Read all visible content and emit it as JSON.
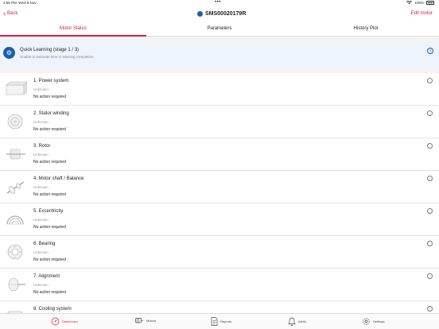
{
  "status_bar": {
    "time": "4:55 PM",
    "date": "Wed 8 Nov",
    "dots": "•••",
    "battery": "100%"
  },
  "nav": {
    "back_label": "Back",
    "title": "SMS00020179R",
    "edit_label": "Edit motor"
  },
  "tabs": [
    {
      "label": "Motor Status"
    },
    {
      "label": "Parameters"
    },
    {
      "label": "History Plot"
    }
  ],
  "learning": {
    "title": "Quick Learning (stage 1 / 3)",
    "subtitle": "Unable to estimate time to learning completion."
  },
  "items": [
    {
      "name": "1. Power system",
      "status": "Unknown",
      "action": "No action required",
      "icon": "power-system-icon"
    },
    {
      "name": "2. Stator winding",
      "status": "Unknown",
      "action": "No action required",
      "icon": "stator-winding-icon"
    },
    {
      "name": "3. Rotor",
      "status": "Unknown",
      "action": "No action required",
      "icon": "rotor-icon"
    },
    {
      "name": "4. Motor shaft / Balance",
      "status": "Unknown",
      "action": "No action required",
      "icon": "motor-shaft-icon"
    },
    {
      "name": "5. Eccentricity",
      "status": "Unknown",
      "action": "No action required",
      "icon": "eccentricity-icon"
    },
    {
      "name": "6. Bearing",
      "status": "Unknown",
      "action": "No action required",
      "icon": "bearing-icon"
    },
    {
      "name": "7. Alignment",
      "status": "Unknown",
      "action": "No action required",
      "icon": "alignment-icon"
    },
    {
      "name": "8. Cooling system",
      "status": "",
      "action": "",
      "icon": "cooling-system-icon"
    }
  ],
  "tab_bar": [
    {
      "label": "Dashboard",
      "icon": "dashboard-icon"
    },
    {
      "label": "Motors",
      "icon": "motors-icon"
    },
    {
      "label": "Reports",
      "icon": "reports-icon"
    },
    {
      "label": "Alerts",
      "icon": "alerts-icon"
    },
    {
      "label": "Settings",
      "icon": "settings-icon"
    }
  ],
  "colors": {
    "accent": "#d4213d",
    "blue": "#1d5fa8",
    "banner_bg": "#eef4fb"
  }
}
